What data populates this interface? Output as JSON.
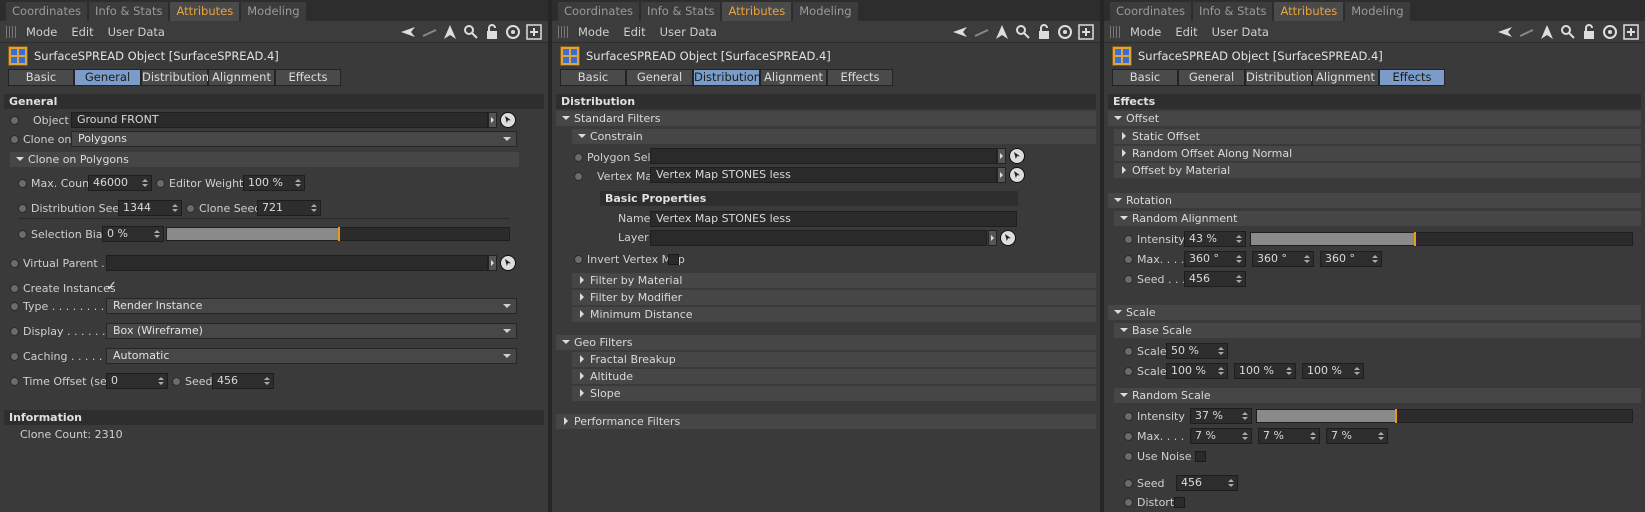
{
  "tabs": [
    "Coordinates",
    "Info & Stats",
    "Attributes",
    "Modeling"
  ],
  "menu": [
    "Mode",
    "Edit",
    "User Data"
  ],
  "object_title": "SurfaceSPREAD Object [SurfaceSPREAD.4]",
  "prop_tabs": [
    "Basic",
    "General",
    "Distribution",
    "Alignment",
    "Effects"
  ],
  "panel1": {
    "section": "General",
    "object_label": "Object",
    "object_value": "Ground FRONT",
    "clone_on_label": "Clone on",
    "clone_on_value": "Polygons",
    "clone_on_polygons": "Clone on Polygons",
    "max_count_label": "Max. Count",
    "max_count": "46000",
    "editor_weight_label": "Editor Weight",
    "editor_weight": "100 %",
    "dist_seed_label": "Distribution Seed",
    "dist_seed": "1344",
    "clone_seed_label": "Clone Seed",
    "clone_seed": "721",
    "selection_bias_label": "Selection Bias",
    "selection_bias": "0 %",
    "virtual_parent_label": "Virtual Parent . .",
    "create_instances_label": "Create Instances",
    "create_instances_check": "✓",
    "type_label": "Type . . . . . . . . . . .",
    "type_value": "Render Instance",
    "display_label": "Display . . . . . . . .",
    "display_value": "Box (Wireframe)",
    "caching_label": "Caching . . . . . . .",
    "caching_value": "Automatic",
    "time_offset_label": "Time Offset (sec)",
    "time_offset": "0",
    "seed_label": "Seed",
    "seed": "456",
    "info_head": "Information",
    "clone_count": "Clone Count: 2310"
  },
  "panel2": {
    "section": "Distribution",
    "standard_filters": "Standard Filters",
    "constrain": "Constrain",
    "polygon_selection_label": "Polygon Selection",
    "vertex_map_label": "Vertex Map. . . .",
    "vertex_map_value": "Vertex Map STONES less",
    "basic_properties": "Basic Properties",
    "name_label": "Name",
    "name_value": "Vertex Map STONES less",
    "layer_label": "Layer",
    "invert_label": "Invert Vertex Map",
    "filter_material": "Filter by Material",
    "filter_modifier": "Filter by Modifier",
    "min_distance": "Minimum Distance",
    "geo_filters": "Geo Filters",
    "fractal_breakup": "Fractal Breakup",
    "altitude": "Altitude",
    "slope": "Slope",
    "performance_filters": "Performance Filters"
  },
  "panel3": {
    "section": "Effects",
    "offset": "Offset",
    "static_offset": "Static Offset",
    "random_offset_normal": "Random Offset Along Normal",
    "offset_by_material": "Offset by Material",
    "rotation": "Rotation",
    "random_alignment": "Random Alignment",
    "intensity_label": "Intensity",
    "rot_intensity": "43 %",
    "max_label": "Max. . . .",
    "rot_max": [
      "360 °",
      "360 °",
      "360 °"
    ],
    "seed_label": "Seed . . .",
    "rot_seed": "456",
    "scale": "Scale",
    "base_scale": "Base Scale",
    "scale_label": "Scale",
    "base_scale_value": "50 %",
    "scale_xyz": [
      "100 %",
      "100 %",
      "100 %"
    ],
    "random_scale": "Random Scale",
    "rs_intensity": "37 %",
    "max_label2": "Max. . . .",
    "rs_max": [
      "7 %",
      "7 %",
      "7 %"
    ],
    "use_noise_label": "Use Noise",
    "seed_label2": "Seed",
    "rs_seed": "456",
    "distort_label": "Distort"
  },
  "colors": {
    "accent": "#e8a33c",
    "active_tab": "#7b9cc8",
    "slider_knob": "#e89a1c"
  }
}
